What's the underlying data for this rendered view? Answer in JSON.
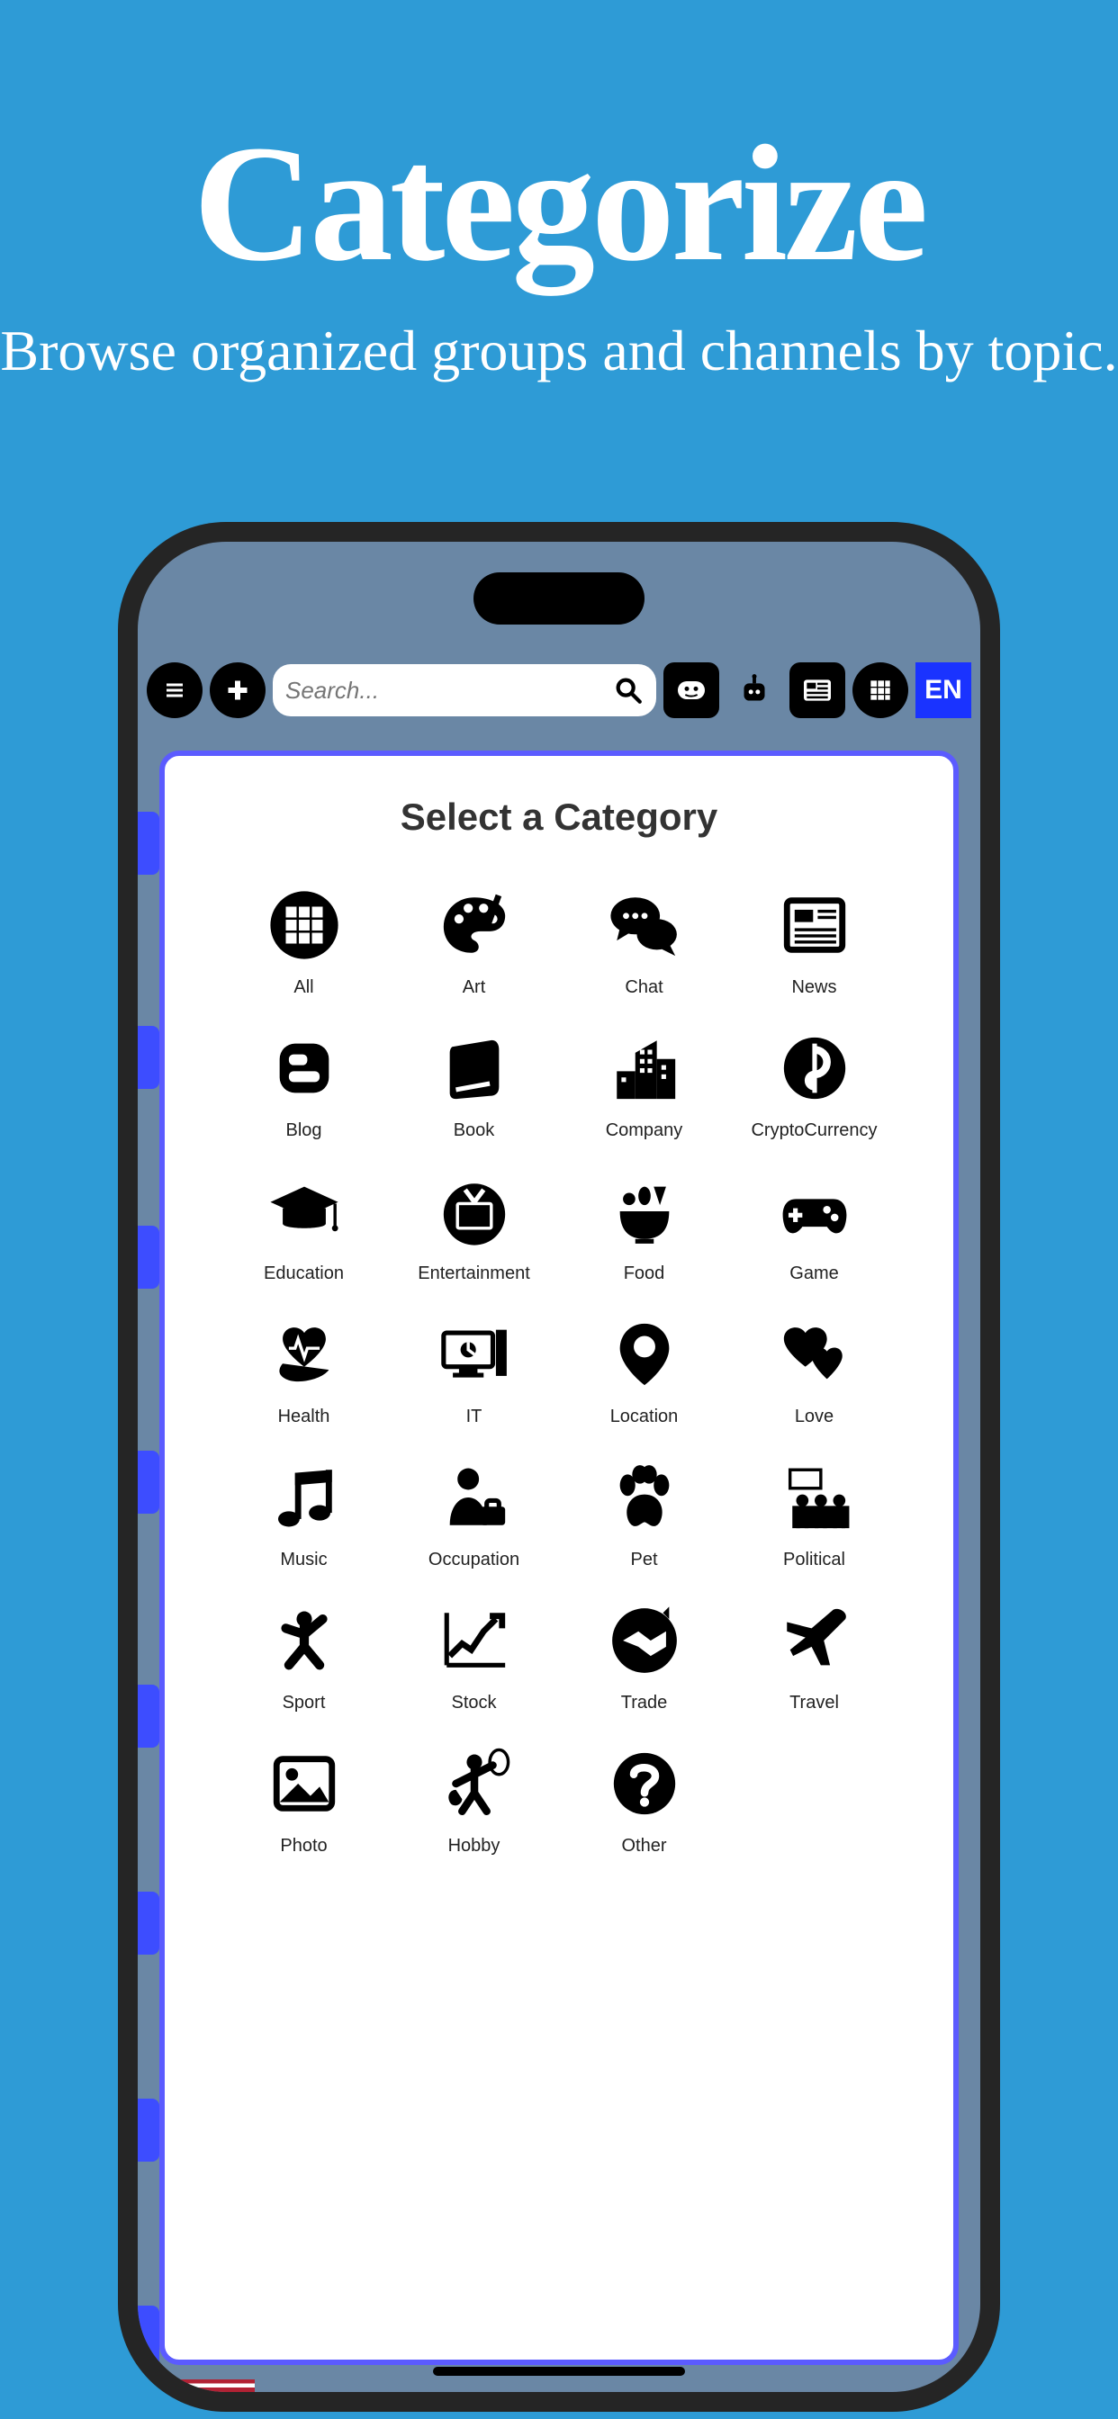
{
  "hero": {
    "title": "Categorize",
    "subtitle": "Browse organized groups and channels by topic."
  },
  "toolbar": {
    "search_placeholder": "Search...",
    "language_label": "EN"
  },
  "card": {
    "title": "Select a Category"
  },
  "categories": [
    {
      "icon": "grid",
      "label": "All"
    },
    {
      "icon": "palette",
      "label": "Art"
    },
    {
      "icon": "chat",
      "label": "Chat"
    },
    {
      "icon": "news",
      "label": "News"
    },
    {
      "icon": "blog",
      "label": "Blog"
    },
    {
      "icon": "book",
      "label": "Book"
    },
    {
      "icon": "company",
      "label": "Company"
    },
    {
      "icon": "crypto",
      "label": "CryptoCurrency"
    },
    {
      "icon": "education",
      "label": "Education"
    },
    {
      "icon": "tv",
      "label": "Entertainment"
    },
    {
      "icon": "food",
      "label": "Food"
    },
    {
      "icon": "gamepad",
      "label": "Game"
    },
    {
      "icon": "health",
      "label": "Health"
    },
    {
      "icon": "computer",
      "label": "IT"
    },
    {
      "icon": "pin",
      "label": "Location"
    },
    {
      "icon": "hearts",
      "label": "Love"
    },
    {
      "icon": "music",
      "label": "Music"
    },
    {
      "icon": "briefcase",
      "label": "Occupation"
    },
    {
      "icon": "paw",
      "label": "Pet"
    },
    {
      "icon": "protest",
      "label": "Political"
    },
    {
      "icon": "sport",
      "label": "Sport"
    },
    {
      "icon": "chart",
      "label": "Stock"
    },
    {
      "icon": "handshake",
      "label": "Trade"
    },
    {
      "icon": "plane",
      "label": "Travel"
    },
    {
      "icon": "photo",
      "label": "Photo"
    },
    {
      "icon": "hobby",
      "label": "Hobby"
    },
    {
      "icon": "question",
      "label": "Other"
    }
  ]
}
